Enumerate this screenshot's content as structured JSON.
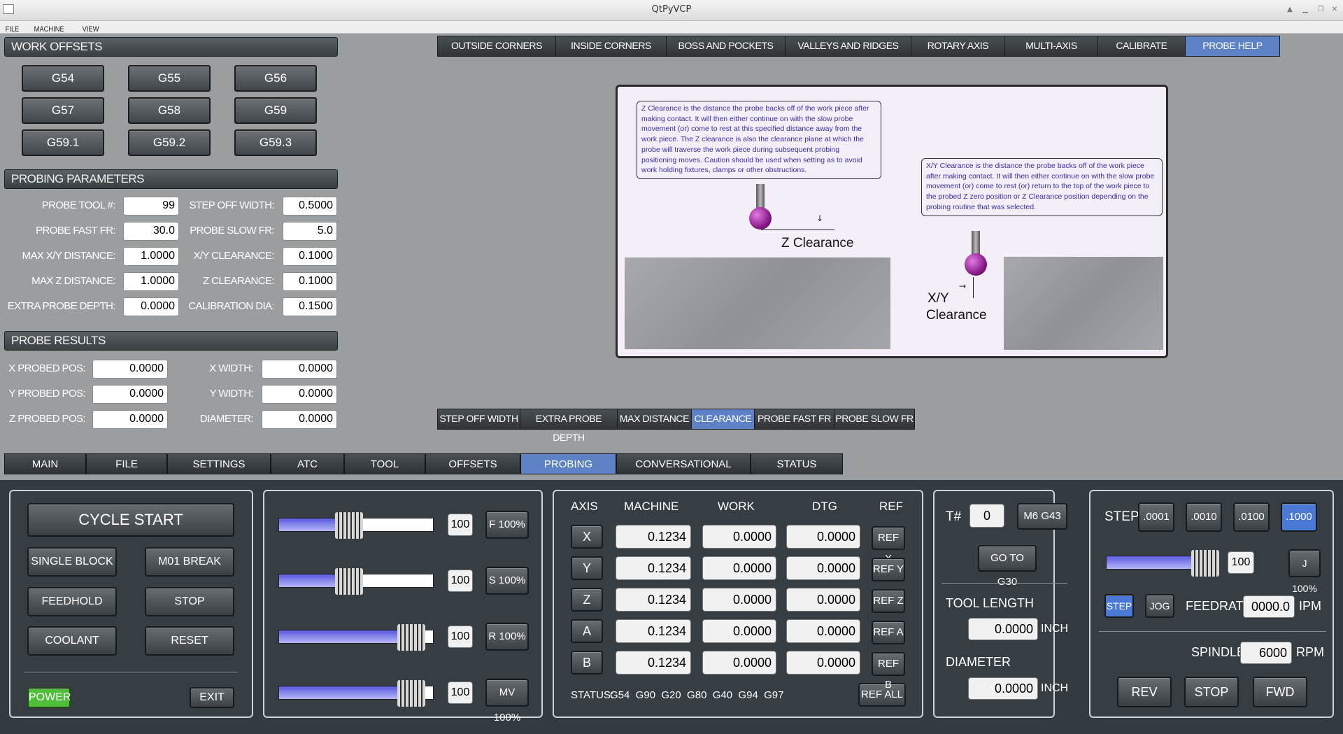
{
  "window": {
    "title": "QtPyVCP"
  },
  "menu": [
    "FILE",
    "MACHINE",
    "VIEW"
  ],
  "work_offsets": {
    "header": "WORK OFFSETS",
    "buttons": [
      "G54",
      "G55",
      "G56",
      "G57",
      "G58",
      "G59",
      "G59.1",
      "G59.2",
      "G59.3"
    ]
  },
  "probing_params": {
    "header": "PROBING PARAMETERS",
    "left": [
      {
        "label": "PROBE TOOL #:",
        "value": "99"
      },
      {
        "label": "PROBE FAST FR:",
        "value": "30.0"
      },
      {
        "label": "MAX X/Y DISTANCE:",
        "value": "1.0000"
      },
      {
        "label": "MAX Z DISTANCE:",
        "value": "1.0000"
      },
      {
        "label": "EXTRA PROBE DEPTH:",
        "value": "0.0000"
      }
    ],
    "right": [
      {
        "label": "STEP OFF WIDTH:",
        "value": "0.5000"
      },
      {
        "label": "PROBE SLOW FR:",
        "value": "5.0"
      },
      {
        "label": "X/Y CLEARANCE:",
        "value": "0.1000"
      },
      {
        "label": "Z CLEARANCE:",
        "value": "0.1000"
      },
      {
        "label": "CALIBRATION DIA:",
        "value": "0.1500"
      }
    ]
  },
  "probe_results": {
    "header": "PROBE RESULTS",
    "left": [
      {
        "label": "X PROBED POS:",
        "value": "0.0000"
      },
      {
        "label": "Y PROBED POS:",
        "value": "0.0000"
      },
      {
        "label": "Z PROBED POS:",
        "value": "0.0000"
      }
    ],
    "right": [
      {
        "label": "X WIDTH:",
        "value": "0.0000"
      },
      {
        "label": "Y WIDTH:",
        "value": "0.0000"
      },
      {
        "label": "DIAMETER:",
        "value": "0.0000"
      }
    ]
  },
  "probe_tabs": [
    "OUTSIDE CORNERS",
    "INSIDE CORNERS",
    "BOSS AND POCKETS",
    "VALLEYS AND RIDGES",
    "ROTARY AXIS",
    "MULTI-AXIS",
    "CALIBRATE",
    "PROBE HELP"
  ],
  "help": {
    "z_note": "Z Clearance is the distance the probe backs off of the work piece after making contact.  It will then either continue on with the slow probe movement (or) come to rest at this specified distance away from the work piece.  The Z clearance is also the clearance plane at which the probe will traverse the work piece during subsequent probing positioning moves.  Caution should be used when setting as to avoid work holding fixtures, clamps or other obstructions.",
    "xy_note": "X/Y Clearance is the distance the probe backs off of the work piece after making contact.  It will then either continue on with the slow probe movement (or) come to rest (or) return to the top of the work piece to the probed Z zero position or Z Clearance position depending on the probing routine that was selected.",
    "z_label": "Z Clearance",
    "xy_label_1": "X/Y",
    "xy_label_2": "Clearance"
  },
  "help_tabs": [
    "STEP OFF WIDTH",
    "EXTRA PROBE DEPTH",
    "MAX DISTANCE",
    "CLEARANCE",
    "PROBE FAST FR",
    "PROBE SLOW FR"
  ],
  "main_tabs": [
    "MAIN",
    "FILE",
    "SETTINGS",
    "ATC",
    "TOOL",
    "OFFSETS",
    "PROBING",
    "CONVERSATIONAL",
    "STATUS"
  ],
  "control": {
    "cycle_start": "CYCLE START",
    "single_block": "SINGLE BLOCK",
    "m01_break": "M01 BREAK",
    "feedhold": "FEEDHOLD",
    "stop": "STOP",
    "coolant": "COOLANT",
    "reset": "RESET",
    "power": "POWER",
    "exit": "EXIT"
  },
  "overrides": [
    {
      "value": "100",
      "button": "F 100%",
      "level": 0.45
    },
    {
      "value": "100",
      "button": "S 100%",
      "level": 0.45
    },
    {
      "value": "100",
      "button": "R 100%",
      "level": 0.85
    },
    {
      "value": "100",
      "button": "MV 100%",
      "level": 0.85
    }
  ],
  "dro": {
    "headers": [
      "AXIS",
      "MACHINE",
      "WORK",
      "DTG",
      "REF"
    ],
    "rows": [
      {
        "axis": "X",
        "machine": "0.1234",
        "work": "0.0000",
        "dtg": "0.0000",
        "ref": "REF X"
      },
      {
        "axis": "Y",
        "machine": "0.1234",
        "work": "0.0000",
        "dtg": "0.0000",
        "ref": "REF Y"
      },
      {
        "axis": "Z",
        "machine": "0.1234",
        "work": "0.0000",
        "dtg": "0.0000",
        "ref": "REF Z"
      },
      {
        "axis": "A",
        "machine": "0.1234",
        "work": "0.0000",
        "dtg": "0.0000",
        "ref": "REF A"
      },
      {
        "axis": "B",
        "machine": "0.1234",
        "work": "0.0000",
        "dtg": "0.0000",
        "ref": "REF B"
      }
    ],
    "status_label": "STATUS:",
    "status_codes": "G54  G90  G20  G80  G40  G94  G97",
    "ref_all": "REF ALL"
  },
  "tool": {
    "t_label": "T#",
    "t_value": "0",
    "m6_button": "M6 G43",
    "g30_button": "GO TO G30",
    "length_label": "TOOL LENGTH",
    "length_value": "0.0000",
    "length_unit": "INCH",
    "diameter_label": "DIAMETER",
    "diameter_value": "0.0000",
    "diameter_unit": "INCH"
  },
  "jog": {
    "step_label": "STEP",
    "steps": [
      ".0001",
      ".0010",
      ".0100",
      ".1000"
    ],
    "active_step": ".1000",
    "jog_value": "100",
    "jog_button": "J 100%",
    "jog_level": 0.88,
    "step_mode": "STEP",
    "jog_mode": "JOG",
    "feedrate_label": "FEEDRATE",
    "feedrate_value": "0000.0",
    "feedrate_unit": "IPM",
    "spindle_label": "SPINDLE",
    "spindle_value": "6000",
    "spindle_unit": "RPM",
    "rev": "REV",
    "stop": "STOP",
    "fwd": "FWD"
  },
  "colors": {
    "accent": "#5d83c6",
    "power": "#4fbf3a",
    "slider": "#5a5ae0"
  }
}
